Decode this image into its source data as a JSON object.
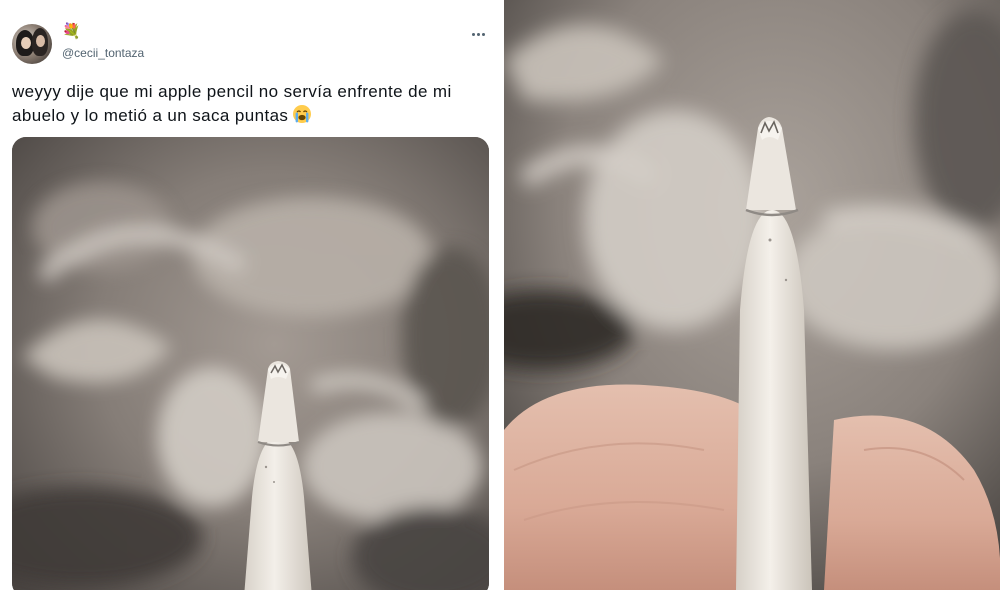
{
  "tweet": {
    "display_name_emoji": "💐",
    "handle": "@cecii_tontaza",
    "text": "weyyy dije que mi apple pencil no servía enfrente de mi abuelo y lo metió a un saca puntas",
    "text_emoji": "😭",
    "more_icon": "more-horizontal-icon",
    "avatar_icon": "profile-avatar"
  },
  "colors": {
    "text_primary": "#0f1419",
    "text_secondary": "#536471",
    "background": "#ffffff",
    "pencil_white": "#eeeae4",
    "blanket_gray": "#8c847d"
  }
}
